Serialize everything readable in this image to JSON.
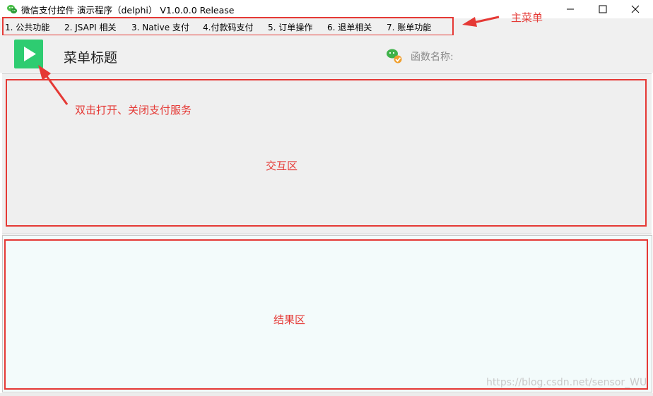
{
  "window": {
    "title": "微信支付控件 演示程序（delphi） V1.0.0.0  Release",
    "app_icon": "wechat-pay-icon",
    "controls": [
      "minimize-icon",
      "maximize-icon",
      "close-icon"
    ]
  },
  "menu": {
    "items": [
      {
        "label": "1. 公共功能"
      },
      {
        "label": "2. JSAPI 相关"
      },
      {
        "label": "3. Native 支付"
      },
      {
        "label": "4.付款码支付"
      },
      {
        "label": "5. 订单操作"
      },
      {
        "label": "6. 退单相关"
      },
      {
        "label": "7. 账单功能"
      }
    ]
  },
  "toolbar": {
    "play_icon": "play-icon",
    "menu_title": "菜单标题",
    "status_icon": "wechat-check-icon",
    "function_name_label": "函数名称:"
  },
  "annotations": {
    "main_menu": "主菜单",
    "toggle_service": "双击打开、关闭支付服务",
    "interaction_area": "交互区",
    "result_area": "结果区"
  },
  "watermark": "https://blog.csdn.net/sensor_WU",
  "colors": {
    "accent_green": "#2ecc71",
    "annotation_red": "#e53935",
    "panel_bg": "#efefef",
    "result_bg": "#f3fbfb"
  }
}
